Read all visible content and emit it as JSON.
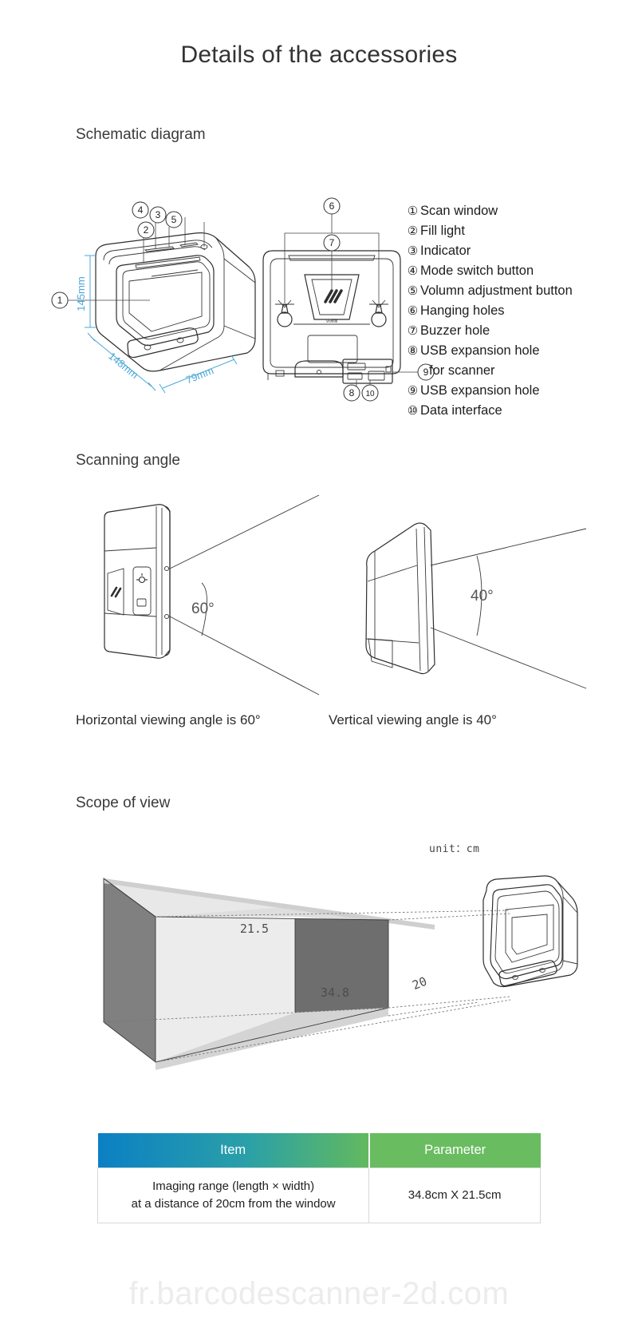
{
  "page": {
    "title": "Details of the accessories"
  },
  "sections": {
    "schematic": {
      "title": "Schematic diagram"
    },
    "scanning_angle": {
      "title": "Scanning angle"
    },
    "scope_of_view": {
      "title": "Scope of view"
    }
  },
  "schematic": {
    "dimensions": {
      "height": "145mm",
      "width": "148mm",
      "depth": "79mm"
    },
    "callouts_front": [
      "1",
      "2",
      "3",
      "4",
      "5"
    ],
    "callouts_back": [
      "6",
      "7",
      "8",
      "9",
      "10"
    ],
    "legend": [
      {
        "num": "①",
        "label": "Scan window"
      },
      {
        "num": "②",
        "label": "Fill light"
      },
      {
        "num": "③",
        "label": "Indicator"
      },
      {
        "num": "④",
        "label": "Mode switch button"
      },
      {
        "num": "⑤",
        "label": "Volumn adjustment button"
      },
      {
        "num": "⑥",
        "label": "Hanging holes"
      },
      {
        "num": "⑦",
        "label": "Buzzer hole"
      },
      {
        "num": "⑧",
        "label": "USB expansion hole"
      },
      {
        "num": "",
        "label": "for scanner"
      },
      {
        "num": "⑨",
        "label": "USB expansion hole"
      },
      {
        "num": "⑩",
        "label": "Data interface"
      }
    ]
  },
  "scanning_angle": {
    "horizontal": {
      "angle_label": "60°",
      "caption": "Horizontal viewing angle is 60°"
    },
    "vertical": {
      "angle_label": "40°",
      "caption": "Vertical viewing angle is 40°"
    }
  },
  "scope_of_view": {
    "unit_label": "unit：cm",
    "height_label": "21.5",
    "width_label": "34.8",
    "distance_label": "20"
  },
  "spec_table": {
    "headers": [
      "Item",
      "Parameter"
    ],
    "rows": [
      {
        "item_line1": "Imaging range (length × width)",
        "item_line2": "at a distance of 20cm from the window",
        "parameter": "34.8cm X 21.5cm"
      }
    ]
  },
  "watermark": "fr.barcodescanner-2d.com",
  "colors": {
    "dimension_blue": "#4aa8d8",
    "header_blue": "#0a80c4",
    "header_green": "#69bc5f",
    "line": "#2e2e2e"
  }
}
